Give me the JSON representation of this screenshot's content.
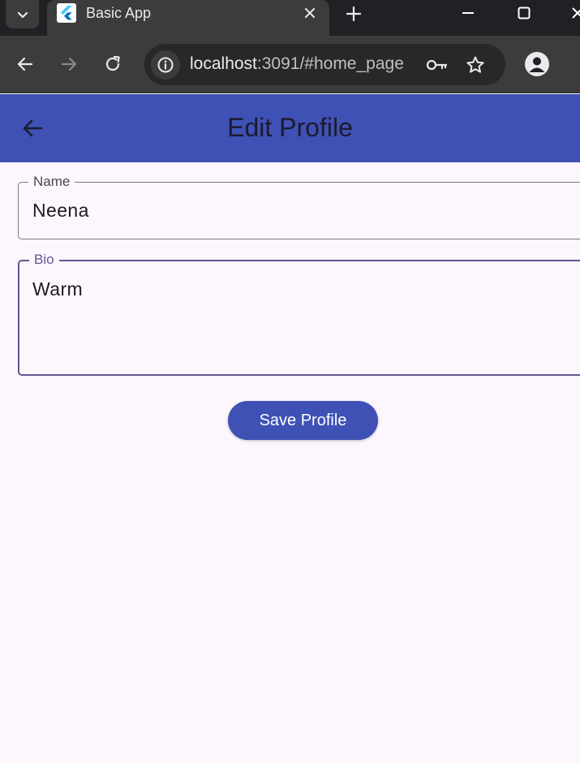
{
  "browser": {
    "tab": {
      "title": "Basic App"
    },
    "url": {
      "host": "localhost",
      "path": ":3091/#home_page"
    }
  },
  "app": {
    "title": "Edit Profile",
    "accent_color": "#3f51b5",
    "focus_color": "#65558f",
    "background_color": "#fdf7fd"
  },
  "form": {
    "name": {
      "label": "Name",
      "value": "Neena"
    },
    "bio": {
      "label": "Bio",
      "value": "Warm"
    },
    "save_label": "Save Profile"
  },
  "icons": {
    "tab_search": "chevron-down-icon",
    "favicon": "flutter-icon",
    "tab_close": "close-icon",
    "new_tab": "plus-icon",
    "back": "arrow-left-icon",
    "forward": "arrow-right-icon",
    "reload": "reload-icon",
    "site_info": "info-icon",
    "password": "key-icon",
    "bookmark": "star-icon",
    "profile": "person-icon"
  }
}
